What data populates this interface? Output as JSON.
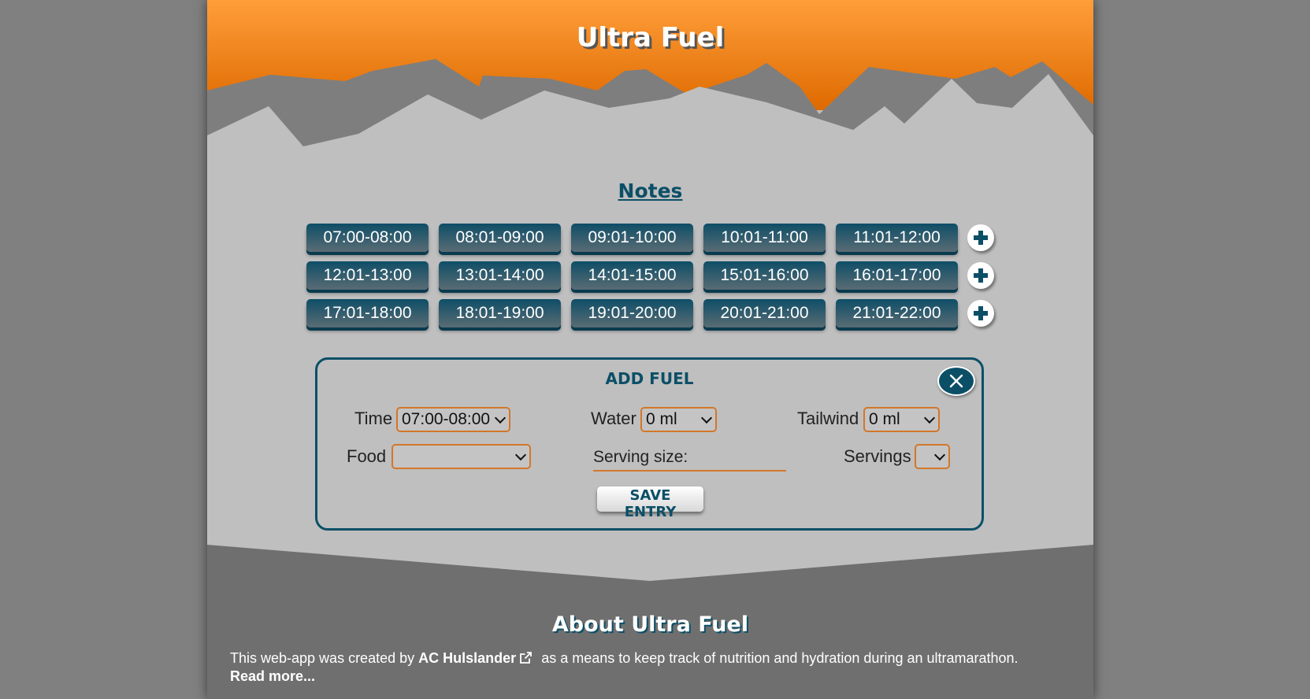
{
  "header": {
    "title": "Ultra Fuel"
  },
  "notes": {
    "title": "Notes",
    "rows": [
      [
        "07:00-08:00",
        "08:01-09:00",
        "09:01-10:00",
        "10:01-11:00",
        "11:01-12:00"
      ],
      [
        "12:01-13:00",
        "13:01-14:00",
        "14:01-15:00",
        "15:01-16:00",
        "16:01-17:00"
      ],
      [
        "17:01-18:00",
        "18:01-19:00",
        "19:01-20:00",
        "20:01-21:00",
        "21:01-22:00"
      ]
    ]
  },
  "add_fuel": {
    "title": "ADD FUEL",
    "time_label": "Time",
    "time_value": "07:00-08:00",
    "water_label": "Water",
    "water_value": "0 ml",
    "tailwind_label": "Tailwind",
    "tailwind_value": "0 ml",
    "food_label": "Food",
    "food_value": "",
    "serving_size_label": "Serving size:",
    "servings_label": "Servings",
    "servings_value": "",
    "save_label": "SAVE ENTRY"
  },
  "about": {
    "title": "About Ultra Fuel",
    "text_before": "This web-app was created by",
    "author": "AC Hulslander",
    "text_after": "as a means to keep track of nutrition and hydration during an ultramarathon.",
    "read_more": "Read more..."
  },
  "colors": {
    "accent": "#0b4f67",
    "header_orange": "#f28c1e",
    "select_border": "#d2772a",
    "background": "#bfbfbf"
  },
  "icons": {
    "add_slot": "plus-icon",
    "close": "close-icon",
    "external_link": "external-link-icon"
  }
}
